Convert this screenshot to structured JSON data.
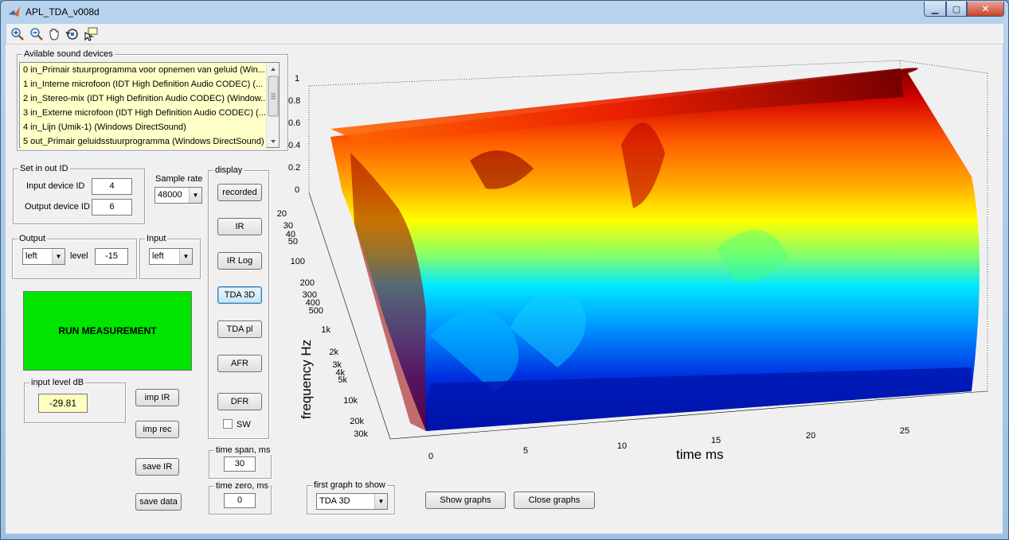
{
  "window": {
    "title": "APL_TDA_v008d"
  },
  "devices": {
    "title": "Avilable sound devices",
    "items": [
      "0 in_Primair stuurprogramma voor opnemen van geluid (Win...",
      "1 in_Interne microfoon (IDT High Definition Audio CODEC) (...",
      "2 in_Stereo-mix (IDT High Definition Audio CODEC) (Window...",
      "3 in_Externe microfoon (IDT High Definition Audio CODEC) (...",
      "4 in_Lijn (Umik-1) (Windows DirectSound)",
      "5 out_Primair geluidsstuurprogramma (Windows DirectSound)"
    ]
  },
  "set_io": {
    "title": "Set in out ID",
    "input_label": "Input device ID",
    "input_value": "4",
    "output_label": "Output device ID",
    "output_value": "6"
  },
  "sample_rate": {
    "label": "Sample rate",
    "value": "48000"
  },
  "output": {
    "title": "Output",
    "channel": "left",
    "level_label": "level",
    "level_value": "-15"
  },
  "input": {
    "title": "Input",
    "channel": "left"
  },
  "run_label": "RUN MEASUREMENT",
  "input_level": {
    "title": "input level dB",
    "value": "-29.81"
  },
  "buttons": {
    "imp_ir": "imp IR",
    "imp_rec": "imp rec",
    "save_ir": "save IR",
    "save_data": "save data",
    "show_graphs": "Show graphs",
    "close_graphs": "Close graphs"
  },
  "display": {
    "title": "display",
    "buttons": [
      "recorded",
      "IR",
      "IR Log",
      "TDA 3D",
      "TDA pl",
      "AFR",
      "DFR"
    ],
    "active": "TDA 3D",
    "sw_label": "SW"
  },
  "time_span": {
    "title": "time span, ms",
    "value": "30"
  },
  "time_zero": {
    "title": "time zero, ms",
    "value": "0"
  },
  "first_graph": {
    "title": "first graph to show",
    "value": "TDA 3D"
  },
  "plot": {
    "z_ticks": [
      "1",
      "0.8",
      "0.6",
      "0.4",
      "0.2",
      "0"
    ],
    "freq_ticks": [
      "20",
      "30",
      "40",
      "50",
      "100",
      "200",
      "300",
      "400",
      "500",
      "1k",
      "2k",
      "3k",
      "4k",
      "5k",
      "10k",
      "20k",
      "30k"
    ],
    "time_ticks": [
      "0",
      "5",
      "10",
      "15",
      "20",
      "25"
    ],
    "ylabel": "frequency   Hz",
    "xlabel": "time   ms",
    "colors": {
      "high": "#8b0000",
      "mid": "#ffff00",
      "low": "#0000c0"
    }
  }
}
